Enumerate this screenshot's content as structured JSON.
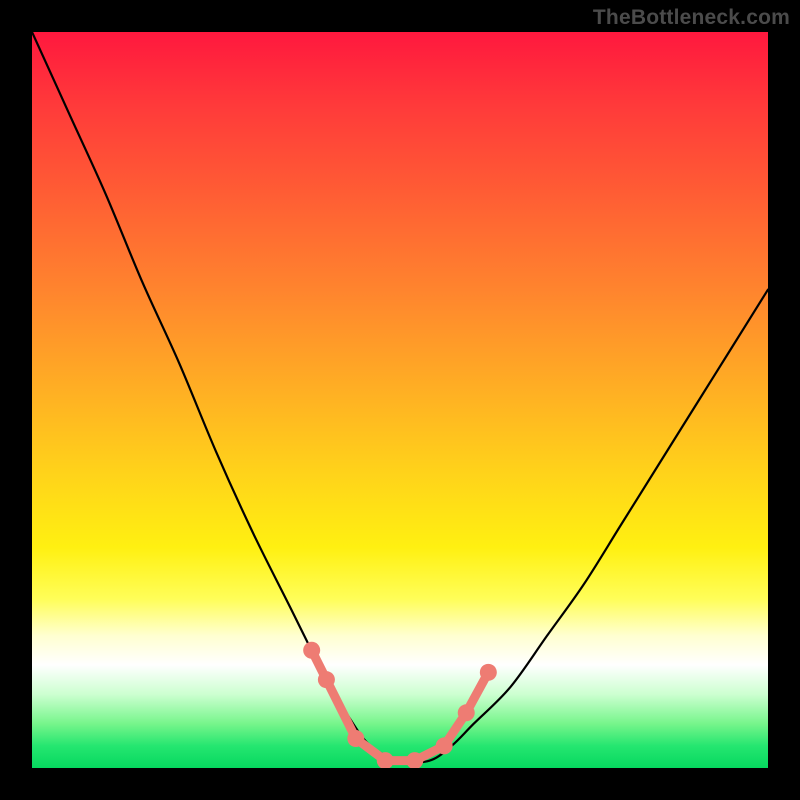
{
  "watermark": "TheBottleneck.com",
  "colors": {
    "frame": "#000000",
    "curve_stroke": "#000000",
    "marker_fill": "#ee7c73",
    "gradient_stops": [
      "#ff183e",
      "#ff3a3a",
      "#ff5d34",
      "#ff842e",
      "#ffad24",
      "#ffd31a",
      "#fff011",
      "#fffe58",
      "#ffffd0",
      "#ffffff",
      "#ccffd0",
      "#76f58b",
      "#25e670",
      "#06d85f"
    ]
  },
  "chart_data": {
    "type": "line",
    "title": "",
    "xlabel": "",
    "ylabel": "",
    "xlim": [
      0,
      100
    ],
    "ylim": [
      0,
      100
    ],
    "x": [
      0,
      5,
      10,
      15,
      20,
      25,
      30,
      35,
      40,
      43,
      46,
      50,
      54,
      57,
      60,
      65,
      70,
      75,
      80,
      85,
      90,
      95,
      100
    ],
    "values": [
      100,
      89,
      78,
      66,
      55,
      43,
      32,
      22,
      12,
      7,
      3,
      1,
      1,
      3,
      6,
      11,
      18,
      25,
      33,
      41,
      49,
      57,
      65
    ],
    "markers_x": [
      38,
      40,
      44,
      48,
      52,
      56,
      59,
      62
    ],
    "markers_y": [
      16,
      12,
      4,
      1,
      1,
      3,
      7.5,
      13
    ]
  }
}
